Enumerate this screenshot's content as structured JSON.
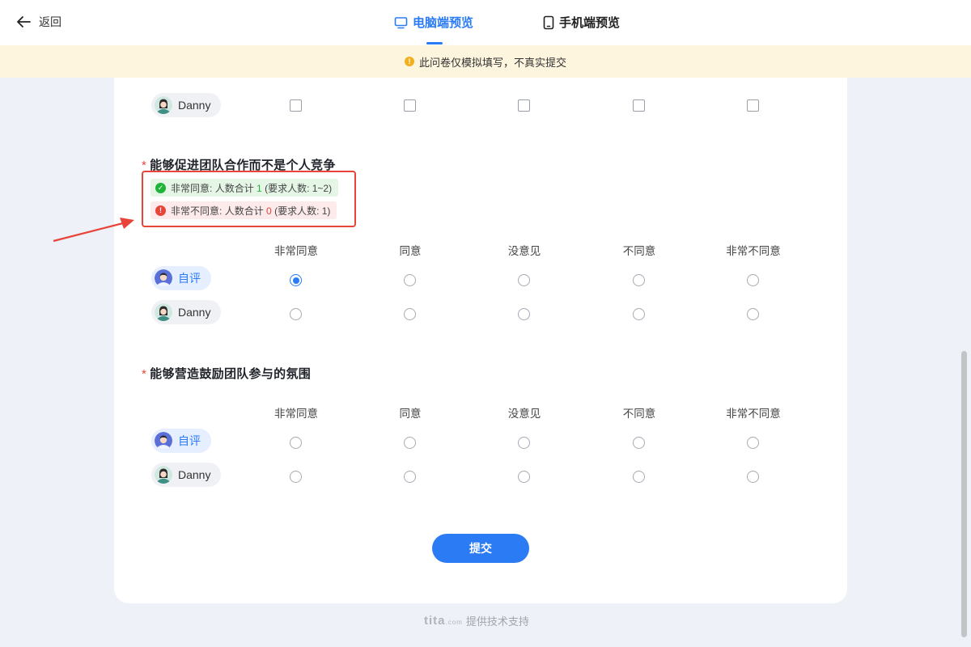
{
  "header": {
    "back_label": "返回",
    "tabs": [
      {
        "label": "电脑端预览",
        "active": true
      },
      {
        "label": "手机端预览",
        "active": false
      }
    ]
  },
  "notice": {
    "text": "此问卷仅模拟填写，不真实提交"
  },
  "participants": {
    "self": "自评",
    "danny": "Danny"
  },
  "columns": [
    "非常同意",
    "同意",
    "没意见",
    "不同意",
    "非常不同意"
  ],
  "previous_question": {
    "rows": [
      {
        "who": "Danny",
        "selected": []
      }
    ]
  },
  "questions": [
    {
      "title": "能够促进团队合作而不是个人竞争",
      "required": true,
      "stats": [
        {
          "status": "ok",
          "option": "非常同意",
          "text_a": "人数合计",
          "count": "1",
          "text_b": "(要求人数: 1~2)"
        },
        {
          "status": "error",
          "option": "非常不同意",
          "text_a": "人数合计",
          "count": "0",
          "text_b": "(要求人数: 1)"
        }
      ],
      "selected": {
        "self": "非常同意",
        "danny": null
      }
    },
    {
      "title": "能够营造鼓励团队参与的氛围",
      "required": true,
      "selected": {
        "self": null,
        "danny": null
      }
    }
  ],
  "required_mark": "*",
  "submit_label": "提交",
  "footer": {
    "brand": "tita",
    "brand_suffix": ".com",
    "text": "提供技术支持"
  },
  "colors": {
    "accent": "#2b7bf5",
    "error": "#e8443a",
    "success": "#1fb437",
    "notice_bg": "#fdf5de"
  },
  "icons": [
    "arrow-left-icon",
    "monitor-icon",
    "phone-icon",
    "warning-icon",
    "check-circle-icon",
    "error-circle-icon",
    "avatar-male-icon",
    "avatar-female-icon"
  ]
}
